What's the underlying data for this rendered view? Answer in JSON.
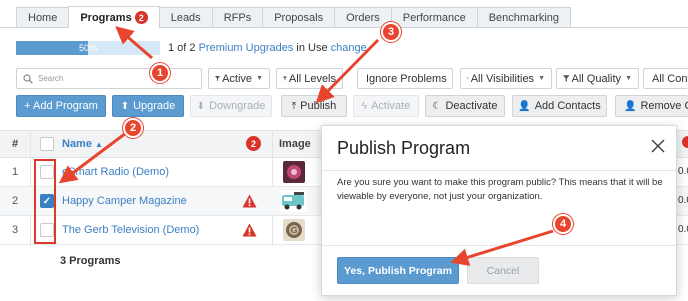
{
  "tabs": [
    {
      "label": "Home"
    },
    {
      "label": "Programs",
      "badge": "2"
    },
    {
      "label": "Leads"
    },
    {
      "label": "RFPs"
    },
    {
      "label": "Proposals"
    },
    {
      "label": "Orders"
    },
    {
      "label": "Performance"
    },
    {
      "label": "Benchmarking"
    }
  ],
  "usage": {
    "percent_label": "50%",
    "fill_fraction": 0.5,
    "count_text": "1 of 2",
    "premium_link": "Premium Upgrades",
    "in_use": "in Use",
    "change_link": "change"
  },
  "search": {
    "placeholder": "Search"
  },
  "filters": [
    "Active",
    "All Levels",
    "Ignore Problems",
    "All Visibilities",
    "All Quality",
    "All Contacts"
  ],
  "actions": [
    {
      "label": "+ Add Program"
    },
    {
      "label": "Upgrade",
      "icon": "arrow-up-icon"
    },
    {
      "label": "Downgrade",
      "icon": "arrow-down-icon"
    },
    {
      "label": "Publish",
      "icon": "upload-icon"
    },
    {
      "label": "Activate",
      "icon": "bolt-icon"
    },
    {
      "label": "Deactivate",
      "icon": "moon-icon"
    },
    {
      "label": "Add Contacts",
      "icon": "add-user-icon"
    },
    {
      "label": "Remove Contacts",
      "icon": "remove-user-icon"
    }
  ],
  "table": {
    "headers": {
      "num": "#",
      "name": "Name",
      "name_arrow": "▲",
      "badge": "2",
      "image": "Image"
    },
    "rows": [
      {
        "num": "1",
        "name": "eSmart Radio (Demo)",
        "checked": false,
        "warning": false,
        "edge": "0.0"
      },
      {
        "num": "2",
        "name": "Happy Camper Magazine",
        "checked": true,
        "warning": true,
        "edge": "0.0"
      },
      {
        "num": "3",
        "name": "The Gerb Television (Demo)",
        "checked": false,
        "warning": true,
        "edge": "0.0"
      }
    ],
    "count": "3 Programs"
  },
  "modal": {
    "title": "Publish Program",
    "body": "Are you sure you want to make this program public? This means that it will be viewable by everyone, not just your organization.",
    "confirm_label": "Yes, Publish Program",
    "cancel_label": "Cancel"
  },
  "steps": [
    "1",
    "2",
    "3",
    "4"
  ],
  "colors": {
    "accent": "#5b9bd0",
    "link": "#3b7fc4",
    "alert": "#d9332a",
    "annotation": "#e8452f"
  }
}
